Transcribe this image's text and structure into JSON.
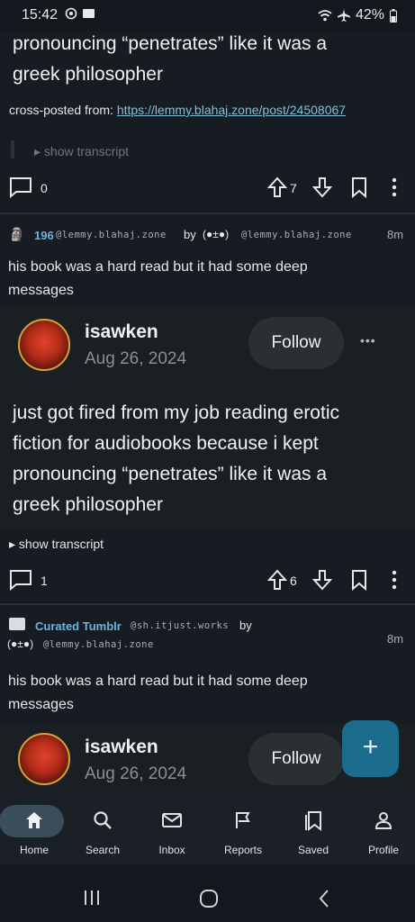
{
  "status_bar": {
    "time": "15:42",
    "battery": "42%"
  },
  "post1": {
    "body_tail_line1": "pronouncing “penetrates” like it was a",
    "body_tail_line2": "greek philosopher",
    "crosspost_label": "cross-posted from: ",
    "crosspost_link": "https://lemmy.blahaj.zone/post/24508067",
    "transcript": "show transcript",
    "comments": "0",
    "score": "7"
  },
  "post2": {
    "community": "196",
    "community_instance": "@lemmy.blahaj.zone",
    "by": "by",
    "author": "(●±●)",
    "author_instance": "@lemmy.blahaj.zone",
    "age": "8m",
    "title_line1": "his book was a hard read but it had some deep",
    "title_line2": "messages",
    "tumblr_user": "isawken",
    "tumblr_date": "Aug 26, 2024",
    "follow_label": "Follow",
    "more": "•••",
    "body_line1": "just got fired from my job reading erotic",
    "body_line2": "fiction for audiobooks because i kept",
    "body_line3": "pronouncing “penetrates” like it was a",
    "body_line4": "greek philosopher",
    "transcript": "show transcript",
    "comments": "1",
    "score": "6"
  },
  "post3": {
    "community": "Curated Tumblr",
    "community_instance": "@sh.itjust.works",
    "by": "by",
    "author": "(●±●)",
    "author_instance": "@lemmy.blahaj.zone",
    "age": "8m",
    "title_line1": "his book was a hard read but it had some deep",
    "title_line2": "messages",
    "tumblr_user": "isawken",
    "tumblr_date": "Aug 26, 2024",
    "follow_label": "Follow"
  },
  "fab": {
    "icon": "plus-icon",
    "label": "+"
  },
  "nav": {
    "home": "Home",
    "search": "Search",
    "inbox": "Inbox",
    "reports": "Reports",
    "saved": "Saved",
    "profile": "Profile"
  },
  "colors": {
    "background": "#12181d",
    "link": "#7fc1d9",
    "accent": "#1b6c8c",
    "community": "#6bb3e0"
  }
}
